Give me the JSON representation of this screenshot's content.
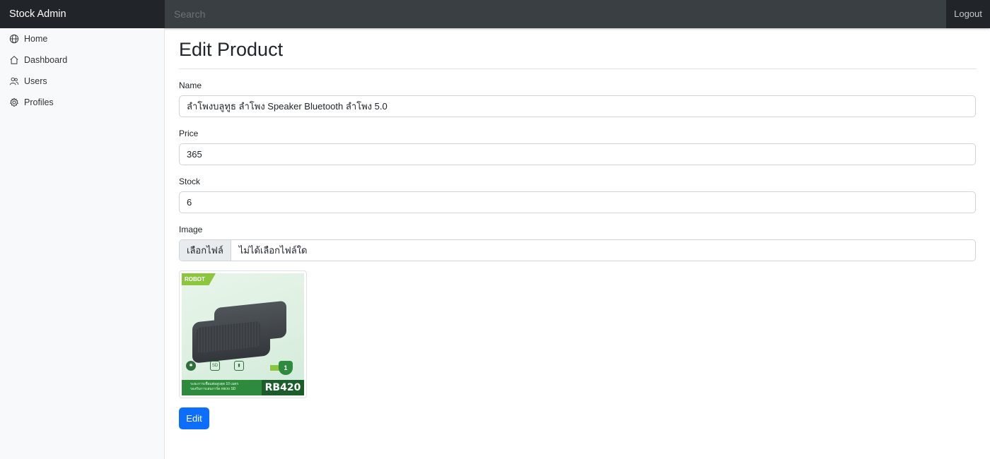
{
  "app": {
    "brand": "Stock Admin"
  },
  "topbar": {
    "search_placeholder": "Search",
    "logout_label": "Logout"
  },
  "sidebar": {
    "items": [
      {
        "label": "Home",
        "icon": "globe-icon"
      },
      {
        "label": "Dashboard",
        "icon": "house-icon"
      },
      {
        "label": "Users",
        "icon": "users-icon"
      },
      {
        "label": "Profiles",
        "icon": "gear-icon"
      }
    ]
  },
  "page": {
    "title": "Edit Product"
  },
  "form": {
    "name_label": "Name",
    "name_value": "ลำโพงบลูทูธ ลำโพง Speaker Bluetooth ลำโพง 5.0",
    "price_label": "Price",
    "price_value": "365",
    "stock_label": "Stock",
    "stock_value": "6",
    "image_label": "Image",
    "file_button": "เลือกไฟล์",
    "file_status": "ไม่ได้เลือกไฟล์ใด",
    "submit_label": "Edit"
  },
  "product_image": {
    "brand_logo": "ROBOT",
    "model": "RB420",
    "caption_line1": "ระยะการเชื่อมต่อสูงสุด 10 เมตร",
    "caption_line2": "รองรับการเล่นการ์ด micro SD",
    "warranty": "1"
  },
  "colors": {
    "primary": "#0d6efd",
    "topbar": "#343a40",
    "brand_bg": "#212529",
    "sidebar_bg": "#f8f9fa"
  }
}
